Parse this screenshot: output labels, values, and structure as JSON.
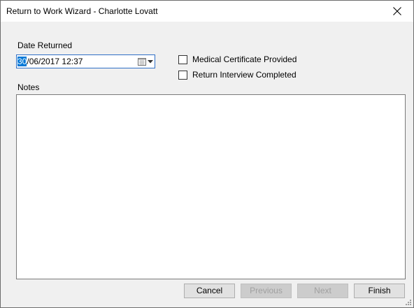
{
  "window": {
    "title": "Return to Work Wizard - Charlotte Lovatt"
  },
  "form": {
    "date_label": "Date Returned",
    "date_value_selected": "30",
    "date_value_rest": "/06/2017 12:37",
    "medical_certificate_label": "Medical Certificate Provided",
    "medical_certificate_checked": false,
    "return_interview_label": "Return Interview Completed",
    "return_interview_checked": false,
    "notes_label": "Notes",
    "notes_value": ""
  },
  "buttons": {
    "cancel": "Cancel",
    "previous": "Previous",
    "next": "Next",
    "finish": "Finish"
  },
  "colors": {
    "selection": "#0078d7",
    "focus_border": "#2f6fc6"
  }
}
